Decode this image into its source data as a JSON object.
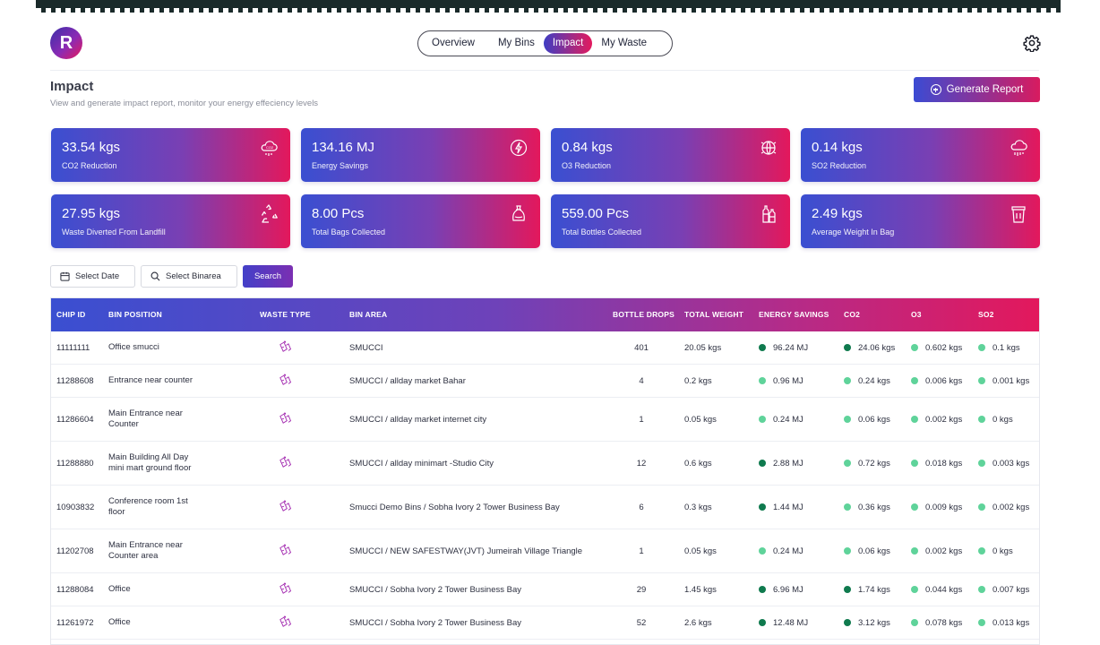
{
  "header": {
    "logo_letter": "R",
    "tabs": [
      {
        "label": "Overview",
        "active": false
      },
      {
        "label": "My Bins",
        "active": false
      },
      {
        "label": "Impact",
        "active": true
      },
      {
        "label": "My Waste",
        "active": false
      }
    ],
    "settings_icon": "gear-icon"
  },
  "page": {
    "title": "Impact",
    "subtitle": "View and generate impact report, monitor your energy effeciency levels",
    "generate_button": "Generate Report"
  },
  "stats": [
    {
      "value": "33.54 kgs",
      "label": "CO2 Reduction",
      "icon": "cloud-icon"
    },
    {
      "value": "134.16 MJ",
      "label": "Energy Savings",
      "icon": "energy-icon"
    },
    {
      "value": "0.84 kgs",
      "label": "O3 Reduction",
      "icon": "globe-icon"
    },
    {
      "value": "0.14 kgs",
      "label": "SO2 Reduction",
      "icon": "cloud-rain-icon"
    },
    {
      "value": "27.95 kgs",
      "label": "Waste Diverted From Landfill",
      "icon": "recycle-icon"
    },
    {
      "value": "8.00 Pcs",
      "label": "Total Bags Collected",
      "icon": "bag-icon"
    },
    {
      "value": "559.00 Pcs",
      "label": "Total Bottles Collected",
      "icon": "bottles-icon"
    },
    {
      "value": "2.49 kgs",
      "label": "Average Weight In Bag",
      "icon": "bin-icon"
    }
  ],
  "filters": {
    "date_label": "Select Date",
    "binarea_label": "Select Binarea",
    "search_label": "Search"
  },
  "table": {
    "columns": [
      "CHIP ID",
      "BIN POSITION",
      "WASTE TYPE",
      "BIN AREA",
      "BOTTLE DROPS",
      "TOTAL WEIGHT",
      "ENERGY SAVINGS",
      "CO2",
      "O3",
      "SO2"
    ],
    "colors": {
      "dark": "#0f7a4e",
      "light": "#5fd39a"
    },
    "rows": [
      {
        "chip": "11111111",
        "position": [
          "Office smucci"
        ],
        "area": "SMUCCI",
        "drops": "401",
        "weight": "20.05 kgs",
        "energy": "96.24 MJ",
        "energy_dot": "dark",
        "co2": "24.06 kgs",
        "co2_dot": "dark",
        "o3": "0.602 kgs",
        "o3_dot": "light",
        "so2": "0.1 kgs",
        "so2_dot": "light"
      },
      {
        "chip": "11288608",
        "position": [
          "Entrance near counter"
        ],
        "area": "SMUCCI / allday market Bahar",
        "drops": "4",
        "weight": "0.2 kgs",
        "energy": "0.96 MJ",
        "energy_dot": "light",
        "co2": "0.24 kgs",
        "co2_dot": "light",
        "o3": "0.006 kgs",
        "o3_dot": "light",
        "so2": "0.001 kgs",
        "so2_dot": "light"
      },
      {
        "chip": "11286604",
        "position": [
          "Main Entrance near",
          "Counter"
        ],
        "area": "SMUCCI / allday market internet city",
        "drops": "1",
        "weight": "0.05 kgs",
        "energy": "0.24 MJ",
        "energy_dot": "light",
        "co2": "0.06 kgs",
        "co2_dot": "light",
        "o3": "0.002 kgs",
        "o3_dot": "light",
        "so2": "0 kgs",
        "so2_dot": "light"
      },
      {
        "chip": "11288880",
        "position": [
          "Main Building All Day",
          "mini mart ground floor"
        ],
        "area": "SMUCCI / allday minimart -Studio City",
        "drops": "12",
        "weight": "0.6 kgs",
        "energy": "2.88 MJ",
        "energy_dot": "dark",
        "co2": "0.72 kgs",
        "co2_dot": "light",
        "o3": "0.018 kgs",
        "o3_dot": "light",
        "so2": "0.003 kgs",
        "so2_dot": "light"
      },
      {
        "chip": "10903832",
        "position": [
          "Conference room 1st",
          "floor"
        ],
        "area": "Smucci Demo Bins / Sobha Ivory 2 Tower Business Bay",
        "drops": "6",
        "weight": "0.3 kgs",
        "energy": "1.44 MJ",
        "energy_dot": "dark",
        "co2": "0.36 kgs",
        "co2_dot": "light",
        "o3": "0.009 kgs",
        "o3_dot": "light",
        "so2": "0.002 kgs",
        "so2_dot": "light"
      },
      {
        "chip": "11202708",
        "position": [
          "Main Entrance near",
          "Counter area"
        ],
        "area": "SMUCCI / NEW SAFESTWAY(JVT) Jumeirah Village Triangle",
        "drops": "1",
        "weight": "0.05 kgs",
        "energy": "0.24 MJ",
        "energy_dot": "light",
        "co2": "0.06 kgs",
        "co2_dot": "light",
        "o3": "0.002 kgs",
        "o3_dot": "light",
        "so2": "0 kgs",
        "so2_dot": "light"
      },
      {
        "chip": "11288084",
        "position": [
          "Office"
        ],
        "area": "SMUCCI / Sobha Ivory 2 Tower Business Bay",
        "drops": "29",
        "weight": "1.45 kgs",
        "energy": "6.96 MJ",
        "energy_dot": "dark",
        "co2": "1.74 kgs",
        "co2_dot": "dark",
        "o3": "0.044 kgs",
        "o3_dot": "light",
        "so2": "0.007 kgs",
        "so2_dot": "light"
      },
      {
        "chip": "11261972",
        "position": [
          "Office"
        ],
        "area": "SMUCCI / Sobha Ivory 2 Tower Business Bay",
        "drops": "52",
        "weight": "2.6 kgs",
        "energy": "12.48 MJ",
        "energy_dot": "dark",
        "co2": "3.12 kgs",
        "co2_dot": "dark",
        "o3": "0.078 kgs",
        "o3_dot": "light",
        "so2": "0.013 kgs",
        "so2_dot": "light"
      }
    ]
  }
}
